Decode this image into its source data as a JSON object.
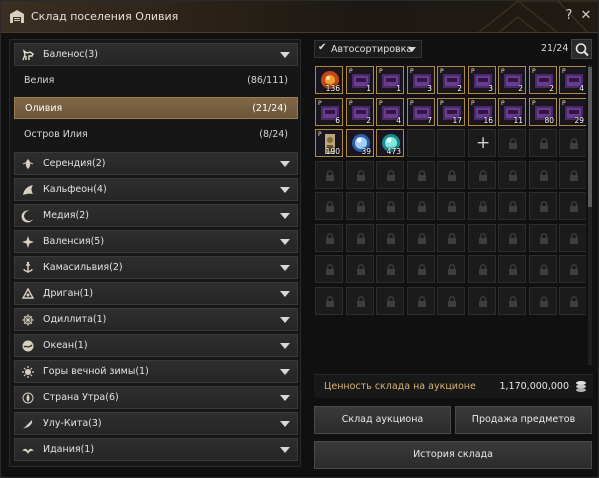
{
  "window": {
    "title": "Склад поселения Оливия",
    "help_icon": "question-icon",
    "close_icon": "close-icon"
  },
  "regions": [
    {
      "label": "Баленос(3)",
      "icon": "horse-icon",
      "expanded": true,
      "cities": [
        {
          "label": "Велия",
          "count": "(86/111)"
        },
        {
          "label": "Оливия",
          "count": "(21/24)",
          "selected": true
        },
        {
          "label": "Остров Илия",
          "count": "(8/24)"
        }
      ]
    },
    {
      "label": "Серендия(2)",
      "icon": "flower-icon"
    },
    {
      "label": "Кальфеон(4)",
      "icon": "wing-icon"
    },
    {
      "label": "Медия(2)",
      "icon": "moon-icon"
    },
    {
      "label": "Валенсия(5)",
      "icon": "compass-icon"
    },
    {
      "label": "Камасильвия(2)",
      "icon": "anchor-icon"
    },
    {
      "label": "Дриган(1)",
      "icon": "triangle-emblem-icon"
    },
    {
      "label": "Одиллита(1)",
      "icon": "star-emblem-icon"
    },
    {
      "label": "Океан(1)",
      "icon": "wave-icon"
    },
    {
      "label": "Горы вечной зимы(1)",
      "icon": "sun-emblem-icon"
    },
    {
      "label": "Страна Утра(6)",
      "icon": "lotus-icon"
    },
    {
      "label": "Улу-Кита(3)",
      "icon": "feather-icon"
    },
    {
      "label": "Идания(1)",
      "icon": "bird-icon"
    }
  ],
  "storage": {
    "autosort_label": "Автосортировка",
    "autosort_checked": true,
    "capacity": "21/24",
    "search_icon": "search-icon",
    "items": [
      {
        "count": "136",
        "kind": "orange-orb"
      },
      {
        "count": "1",
        "kind": "purple-box",
        "grade": "P"
      },
      {
        "count": "1",
        "kind": "purple-box",
        "grade": "P"
      },
      {
        "count": "3",
        "kind": "purple-box",
        "grade": "P"
      },
      {
        "count": "2",
        "kind": "purple-box",
        "grade": "P"
      },
      {
        "count": "3",
        "kind": "purple-box",
        "grade": "P"
      },
      {
        "count": "2",
        "kind": "purple-box",
        "grade": "P"
      },
      {
        "count": "2",
        "kind": "purple-box",
        "grade": "P"
      },
      {
        "count": "4",
        "kind": "purple-box",
        "grade": "P"
      },
      {
        "count": "6",
        "kind": "purple-box",
        "grade": "P"
      },
      {
        "count": "2",
        "kind": "purple-box",
        "grade": "P"
      },
      {
        "count": "4",
        "kind": "purple-box",
        "grade": "P"
      },
      {
        "count": "7",
        "kind": "purple-box",
        "grade": "P"
      },
      {
        "count": "17",
        "kind": "purple-box",
        "grade": "P"
      },
      {
        "count": "16",
        "kind": "purple-box",
        "grade": "P"
      },
      {
        "count": "11",
        "kind": "purple-box",
        "grade": "P"
      },
      {
        "count": "80",
        "kind": "purple-box",
        "grade": "P"
      },
      {
        "count": "29",
        "kind": "purple-box",
        "grade": "P"
      },
      {
        "count": "190",
        "kind": "scroll",
        "grade": "P"
      },
      {
        "count": "39",
        "kind": "blue-orb"
      },
      {
        "count": "473",
        "kind": "cyan-orb"
      }
    ],
    "empty_slots": 3,
    "plus_slot": true,
    "total_visible_slots": 72,
    "auction_value_label": "Ценность склада на аукционе",
    "auction_value": "1,170,000,000",
    "coin_icon": "silver-coins-icon"
  },
  "buttons": {
    "auction_storage": "Склад аукциона",
    "sell_items": "Продажа предметов",
    "storage_history": "История склада"
  },
  "colors": {
    "selected_row": "#7a6142",
    "value_label": "#d8b376",
    "item_border": "#b08a3c"
  }
}
